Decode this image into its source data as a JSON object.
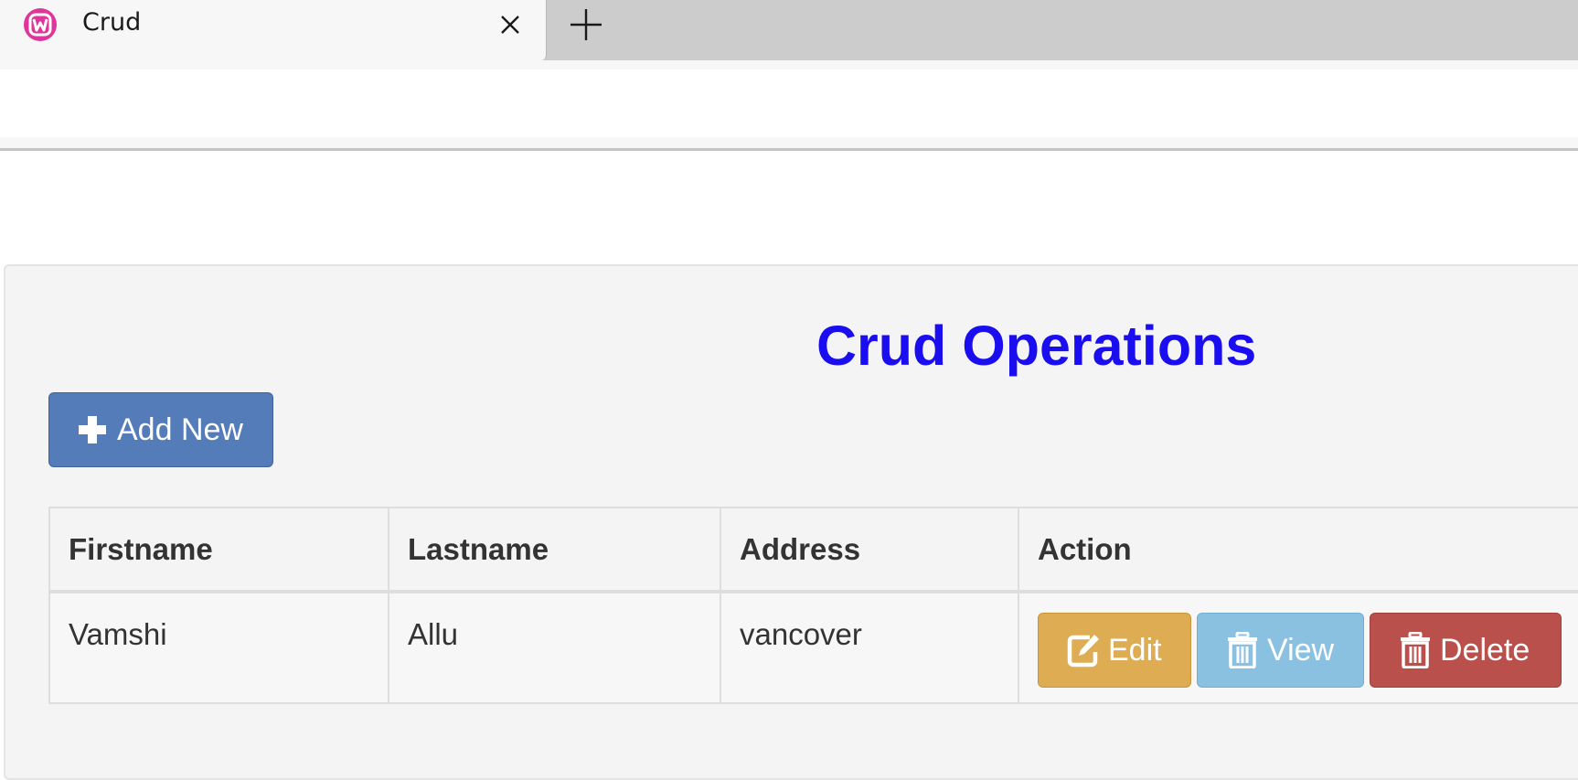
{
  "browser": {
    "tab_title": "Crud"
  },
  "page": {
    "title": "Crud Operations",
    "add_button_label": "Add New"
  },
  "table": {
    "headers": [
      "Firstname",
      "Lastname",
      "Address",
      "Action"
    ],
    "rows": [
      {
        "firstname": "Vamshi",
        "lastname": "Allu",
        "address": "vancover"
      }
    ]
  },
  "actions": {
    "edit_label": "Edit",
    "view_label": "View",
    "delete_label": "Delete"
  },
  "colors": {
    "title": "#1a0ef0",
    "add_button": "#547cb8",
    "edit_button": "#deac52",
    "view_button": "#8bc1e0",
    "delete_button": "#b9504c"
  },
  "icons": {
    "favicon": "wamp-icon",
    "tab_close": "close-icon",
    "new_tab": "plus-icon",
    "add": "plus-icon",
    "edit": "edit-icon",
    "view": "trash-icon",
    "delete": "trash-icon"
  }
}
